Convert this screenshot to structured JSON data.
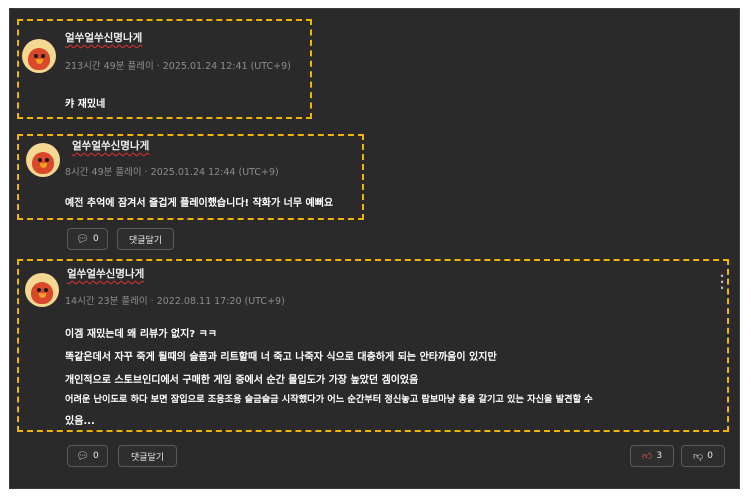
{
  "comments": [
    {
      "author": "얼쑤얼쑤신명나게",
      "meta": "213시간 49분 플레이 · 2025.01.24 12:41 (UTC+9)",
      "lines": [
        "캬 재밌네"
      ]
    },
    {
      "author": "얼쑤얼쑤신명나게",
      "meta": "8시간 49분 플레이 · 2025.01.24 12:44 (UTC+9)",
      "lines": [
        "예전 추억에 잠겨서 즐겁게 플레이했습니다! 작화가 너무 예뻐요"
      ],
      "reply_count": "0",
      "reply_label": "댓글달기"
    },
    {
      "author": "얼쑤얼쑤신명나게",
      "meta": "14시간 23분 플레이 · 2022.08.11 17:20 (UTC+9)",
      "lines": [
        "이겜 재밌는데 왜 리뷰가 없지? ㅋㅋ",
        "똑같은데서 자꾸 죽게 될때의 슬픔과 리트할때 너 죽고 나죽자 식으로 대충하게 되는 안타까움이 있지만",
        "개인적으로 스토브인디에서 구매한 게임 중에서 순간 몰입도가 가장 높았던 겜이었음",
        "어려운 난이도로 하다 보면 잠입으로 조용조용 슬금슬금 시작했다가 어느 순간부터 정신놓고 람보마냥 총을 갈기고 있는 자신을 발견할 수",
        "있음..."
      ],
      "reply_count": "0",
      "reply_label": "댓글달기",
      "like_count": "3",
      "dislike_count": "0"
    }
  ],
  "icons": {
    "comment": "comment-bubble-icon",
    "like": "thumbs-up-icon",
    "dislike": "thumbs-down-icon",
    "more": "more-vertical-icon"
  },
  "colors": {
    "highlight": "#f2b500",
    "background": "#2a2a2a",
    "like": "#e05d3a"
  }
}
